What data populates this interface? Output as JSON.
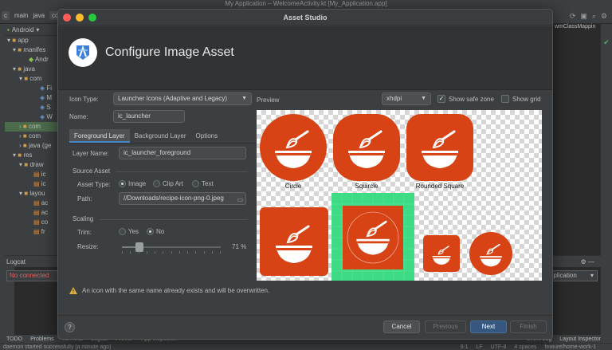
{
  "ide": {
    "window_title": "My Application – WelcomeActivity.kt [My_Application.app]",
    "breadcrumbs": [
      "c",
      "main",
      "java",
      "co"
    ],
    "project_view": "Android",
    "tree": [
      {
        "label": "app",
        "kind": "folder"
      },
      {
        "label": "manifes",
        "kind": "folder"
      },
      {
        "label": "Andr",
        "kind": "file"
      },
      {
        "label": "java",
        "kind": "folder"
      },
      {
        "label": "com",
        "kind": "folder"
      },
      {
        "label": "Fi",
        "kind": "kt"
      },
      {
        "label": "M",
        "kind": "kt"
      },
      {
        "label": "S",
        "kind": "kt"
      },
      {
        "label": "W",
        "kind": "kt"
      },
      {
        "label": "com",
        "kind": "folder",
        "selected": true
      },
      {
        "label": "com",
        "kind": "folder"
      },
      {
        "label": "java (ge",
        "kind": "folder"
      },
      {
        "label": "res",
        "kind": "folder"
      },
      {
        "label": "draw",
        "kind": "folder"
      },
      {
        "label": "ic",
        "kind": "file"
      },
      {
        "label": "ic",
        "kind": "file"
      },
      {
        "label": "layou",
        "kind": "folder"
      },
      {
        "label": "ac",
        "kind": "file"
      },
      {
        "label": "ac",
        "kind": "file"
      },
      {
        "label": "co",
        "kind": "file"
      },
      {
        "label": "fr",
        "kind": "file"
      }
    ],
    "editor_tab": "wmClassMappin",
    "logcat": {
      "title": "Logcat",
      "device": "No connected",
      "app": "pplication"
    },
    "bottom_tabs": [
      "TODO",
      "Problems",
      "Terminal",
      "Logcat",
      "Profiler",
      "App Inspection"
    ],
    "bottom_right": [
      "Event Log",
      "Layout Inspector"
    ],
    "status": "daemon started successfully (a minute ago)",
    "status_right": [
      "9:1",
      "LF",
      "UTF-8",
      "4 spaces",
      "feature/home-work-1"
    ]
  },
  "dialog": {
    "title": "Asset Studio",
    "header_title": "Configure Image Asset",
    "icon_type_label": "Icon Type:",
    "icon_type_value": "Launcher Icons (Adaptive and Legacy)",
    "name_label": "Name:",
    "name_value": "ic_launcher",
    "tabs": [
      "Foreground Layer",
      "Background Layer",
      "Options"
    ],
    "active_tab": 0,
    "layer_name_label": "Layer Name:",
    "layer_name_value": "ic_launcher_foreground",
    "source_asset_label": "Source Asset",
    "asset_type_label": "Asset Type:",
    "asset_types": [
      "Image",
      "Clip Art",
      "Text"
    ],
    "asset_type_selected": 0,
    "path_label": "Path:",
    "path_value": "//Downloads/recipe-icon-png-0.jpeg",
    "scaling_label": "Scaling",
    "trim_label": "Trim:",
    "trim_options": [
      "Yes",
      "No"
    ],
    "trim_selected": 1,
    "resize_label": "Resize:",
    "resize_value": 71,
    "resize_text": "71 %",
    "preview_label": "Preview",
    "density_value": "xhdpi",
    "show_safe_zone_label": "Show safe zone",
    "show_safe_zone": true,
    "show_grid_label": "Show grid",
    "show_grid": false,
    "preview_captions": [
      "Circle",
      "Squircle",
      "Rounded Square"
    ],
    "icon_colors": {
      "orange": "#d84315",
      "white": "#ffffff",
      "grid_green": "#3ddc84"
    },
    "warning": "An icon with the same name already exists and will be overwritten.",
    "buttons": {
      "help": "?",
      "cancel": "Cancel",
      "previous": "Previous",
      "next": "Next",
      "finish": "Finish"
    }
  }
}
